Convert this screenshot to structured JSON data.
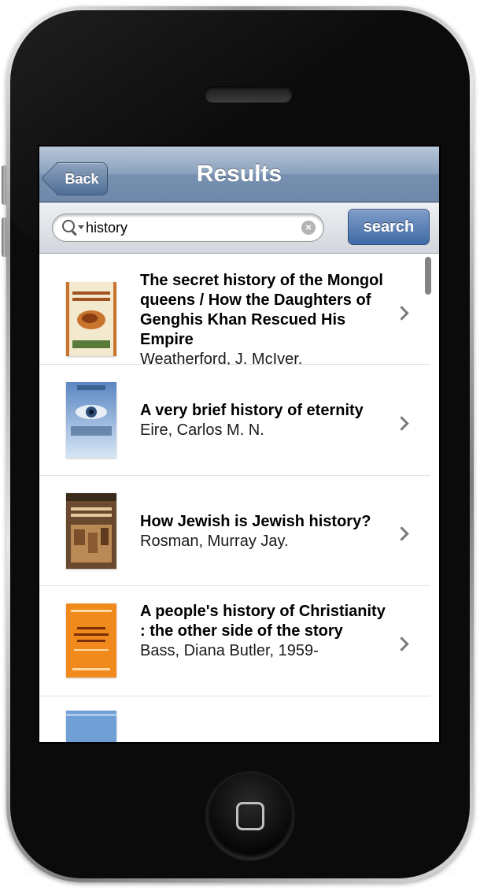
{
  "navbar": {
    "back_label": "Back",
    "title": "Results"
  },
  "search": {
    "value": "history",
    "button_label": "search",
    "clear_symbol": "×"
  },
  "results": [
    {
      "title": "The secret history of the Mongol queens / How the Daughters of Genghis Khan Rescued His Empire",
      "author": "Weatherford, J. McIver.",
      "cover_colors": [
        "#f3e9cf",
        "#c9742d"
      ]
    },
    {
      "title": "A very brief history of eternity",
      "author": "Eire, Carlos M. N.",
      "cover_colors": [
        "#7fa7d6",
        "#2d4f7a"
      ]
    },
    {
      "title": "How Jewish is Jewish history?",
      "author": "Rosman, Murray Jay.",
      "cover_colors": [
        "#6a4a2e",
        "#b98a55"
      ]
    },
    {
      "title": "A people's history of Christianity : the other side of the story",
      "author": "Bass, Diana Butler, 1959-",
      "cover_colors": [
        "#f08a1c",
        "#d9671a"
      ]
    }
  ],
  "icons": {
    "search": "magnifier-icon",
    "chevron": "chevron-right-icon",
    "clear": "clear-icon",
    "home": "home-button-icon"
  }
}
